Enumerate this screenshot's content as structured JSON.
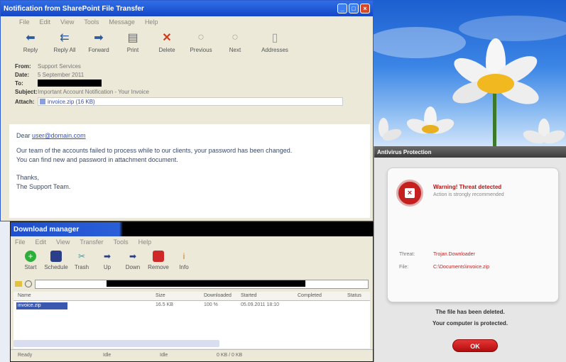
{
  "email": {
    "title": "Notification from SharePoint File Transfer",
    "menu": [
      "File",
      "Edit",
      "View",
      "Tools",
      "Message",
      "Help"
    ],
    "toolbar": [
      "Reply",
      "Reply All",
      "Forward",
      "Print",
      "Delete",
      "Previous",
      "Next",
      "Addresses"
    ],
    "headers": {
      "from_label": "From:",
      "from_value": "Support Services",
      "date_label": "Date:",
      "date_value": "5 September 2011",
      "to_label": "To:",
      "subject_label": "Subject:",
      "subject_value": "Important Account Notification - Your Invoice",
      "attach_label": "Attach:",
      "attach_value": "invoice.zip (16 KB)"
    },
    "body": {
      "greeting_prefix": "Dear ",
      "greeting_link": "user@domain.com",
      "line1": "Our team of the accounts failed to process while to our clients, your password has been changed.",
      "line2": "You can find new and password in attachment document.",
      "sign1": "Thanks,",
      "sign2": "The Support Team."
    }
  },
  "downloader": {
    "title": "Download manager",
    "menu": [
      "File",
      "Edit",
      "View",
      "Transfer",
      "Tools",
      "Help"
    ],
    "toolbar": [
      "Start",
      "Schedule",
      "Trash",
      "Up",
      "Down",
      "Remove",
      "Info"
    ],
    "columns": [
      "Name",
      "Size",
      "Downloaded",
      "Started",
      "Completed",
      "Status"
    ],
    "row": {
      "name": "invoice.zip",
      "size": "16.5 KB",
      "downloaded": "100 %",
      "started": "05.09.2011 18:10"
    },
    "status": [
      "Ready",
      "Idle",
      "Idle",
      "0 KB / 0 KB"
    ]
  },
  "alert": {
    "title": "Antivirus Protection",
    "heading": "Warning! Threat detected",
    "subheading": "Action is strongly recommended",
    "threat_label": "Threat:",
    "threat_value": "Trojan.Downloader",
    "file_label": "File:",
    "file_value": "C:\\Documents\\invoice.zip",
    "message1": "The file has been deleted.",
    "message2": "Your computer is protected.",
    "ok_label": "OK"
  },
  "colors": {
    "xp_blue": "#2f6fe6",
    "alert_red": "#c42020"
  }
}
